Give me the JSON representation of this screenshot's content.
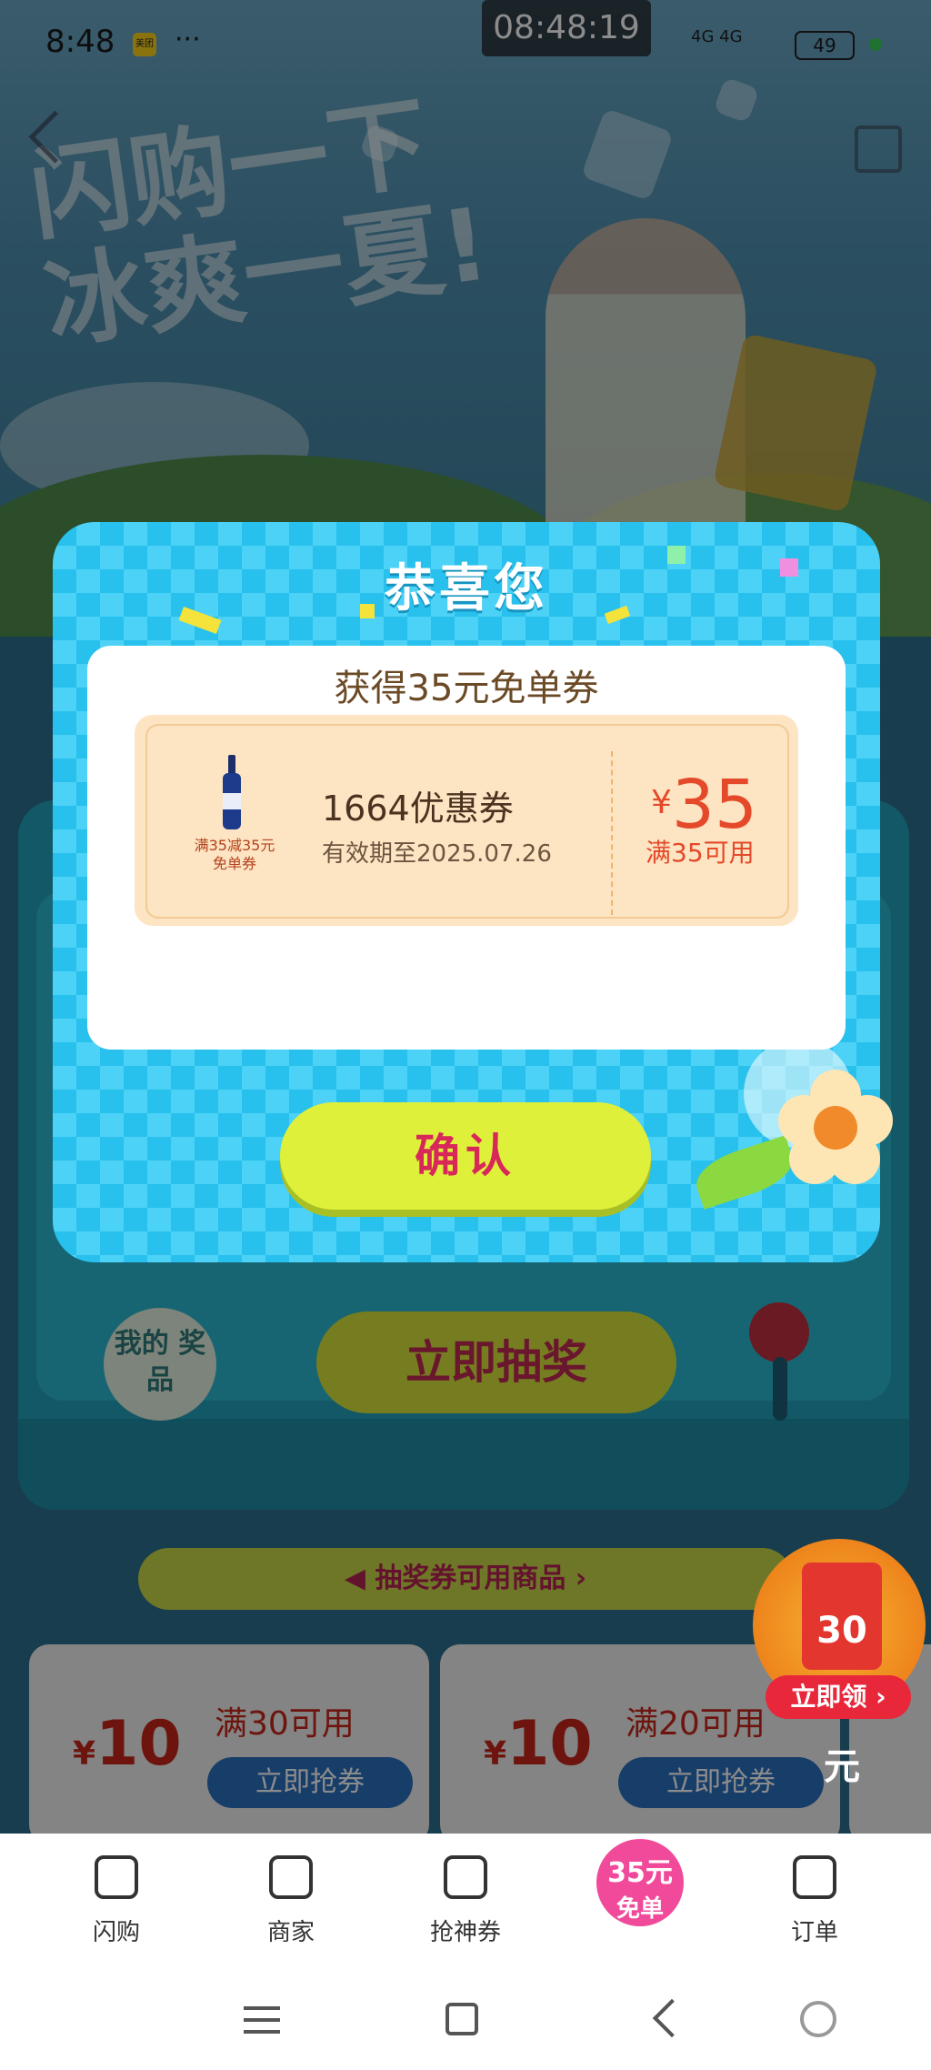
{
  "status_bar": {
    "time": "8:48",
    "app_badge": "美团",
    "more": "···",
    "clock_overlay": "08:48:19",
    "network": "4G 4G",
    "battery": "49"
  },
  "hero": {
    "title": "闪购一下 冰爽一夏!"
  },
  "machine": {
    "my_prizes_label": "我的 奖品",
    "draw_button": "立即抽奖"
  },
  "banner": {
    "label": "抽奖券可用商品"
  },
  "coupons": [
    {
      "currency": "¥",
      "amount": "10",
      "condition": "满30可用",
      "button": "立即抢券"
    },
    {
      "currency": "¥",
      "amount": "10",
      "condition": "满20可用",
      "button": "立即抢券"
    }
  ],
  "red_packet": {
    "amount": "30元",
    "claim": "立即领"
  },
  "dialog": {
    "title": "恭喜您",
    "headline": "获得35元免单券",
    "voucher": {
      "product_caption": "满35减35元 免单券",
      "name": "1664优惠券",
      "validity": "有效期至2025.07.26",
      "currency": "¥",
      "amount": "35",
      "condition": "满35可用"
    },
    "confirm": "确认"
  },
  "tabbar": {
    "items": [
      {
        "label": "闪购",
        "icon": "flash-bag-icon"
      },
      {
        "label": "商家",
        "icon": "store-icon"
      },
      {
        "label": "抢神券",
        "icon": "coupon-icon"
      },
      {
        "label": "35元 免单",
        "icon": "free-order-badge"
      },
      {
        "label": "订单",
        "icon": "order-icon"
      }
    ],
    "free_num": "35元",
    "free_text": "免单"
  },
  "colors": {
    "dialog_bg": "#28c0ec",
    "confirm_bg": "#dff03a",
    "confirm_text": "#d8285a",
    "price_red": "#e4492a",
    "voucher_bg": "#fde4c2"
  }
}
